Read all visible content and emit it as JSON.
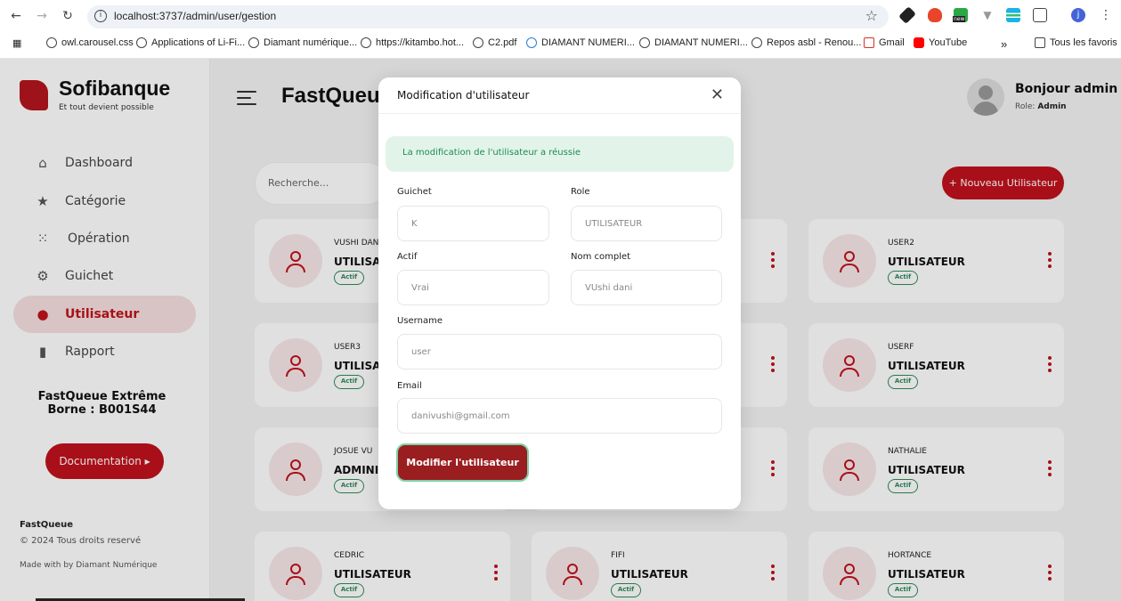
{
  "browser": {
    "url": "localhost:3737/admin/user/gestion",
    "bookmarks": [
      "owl.carousel.css",
      "Applications of Li-Fi...",
      "Diamant numérique...",
      "https://kitambo.hot...",
      "C2.pdf",
      "DIAMANT NUMERI...",
      "DIAMANT NUMERI...",
      "Repos asbl - Renou...",
      "Gmail",
      "YouTube"
    ],
    "more": "»",
    "all_bookmarks": "Tous les favoris",
    "ext_badge": "new"
  },
  "sidebar": {
    "brand": "Sofibanque",
    "tagline": "Et tout devient possible",
    "items": [
      {
        "label": "Dashboard"
      },
      {
        "label": "Catégorie"
      },
      {
        "label": "Opération"
      },
      {
        "label": "Guichet"
      },
      {
        "label": "Utilisateur"
      },
      {
        "label": "Rapport"
      }
    ],
    "promo_line1": "FastQueue Extrême",
    "promo_line2": "Borne : B001S44",
    "doc_button": "Documentation ▸",
    "footer_brand": "FastQueue",
    "footer_copy": "© 2024 Tous droits reservé",
    "footer_made": "Made with      by Diamant Numérique"
  },
  "header": {
    "title": "FastQueue",
    "greeting": "Bonjour admin",
    "role_label": "Role:",
    "role_value": "Admin"
  },
  "toolbar": {
    "search_placeholder": "Recherche...",
    "new_user": "+ Nouveau Utilisateur"
  },
  "cards": [
    {
      "name": "VUSHI DANI",
      "role": "UTILISATEUR",
      "status": "Actif"
    },
    {
      "name": "USER2",
      "role": "UTILISATEUR",
      "status": "Actif"
    },
    {
      "name": "USER3",
      "role": "UTILISATEUR",
      "status": "Actif"
    },
    {
      "name": "USERF",
      "role": "UTILISATEUR",
      "status": "Actif"
    },
    {
      "name": "JOSUE VU",
      "role": "ADMINISTRATEUR",
      "status": "Actif"
    },
    {
      "name": "NATHALIE",
      "role": "UTILISATEUR",
      "status": "Actif"
    },
    {
      "name": "CEDRIC",
      "role": "UTILISATEUR",
      "status": "Actif"
    },
    {
      "name": "FIFI",
      "role": "UTILISATEUR",
      "status": "Actif"
    },
    {
      "name": "HORTANCE",
      "role": "UTILISATEUR",
      "status": "Actif"
    }
  ],
  "modal": {
    "title": "Modification d'utilisateur",
    "success": "La modification de l'utilisateur a réussie",
    "fields": {
      "guichet": {
        "label": "Guichet",
        "value": "K"
      },
      "role": {
        "label": "Role",
        "value": "UTILISATEUR"
      },
      "actif": {
        "label": "Actif",
        "value": "Vrai"
      },
      "fullname": {
        "label": "Nom complet",
        "value": "VUshi dani"
      },
      "username": {
        "label": "Username",
        "value": "user"
      },
      "email": {
        "label": "Email",
        "value": "danivushi@gmail.com"
      }
    },
    "submit": "Modifier l'utilisateur"
  },
  "colors": {
    "brand": "#c1121c",
    "success": "#1f8a4c",
    "submit": "#9a1d1f"
  }
}
